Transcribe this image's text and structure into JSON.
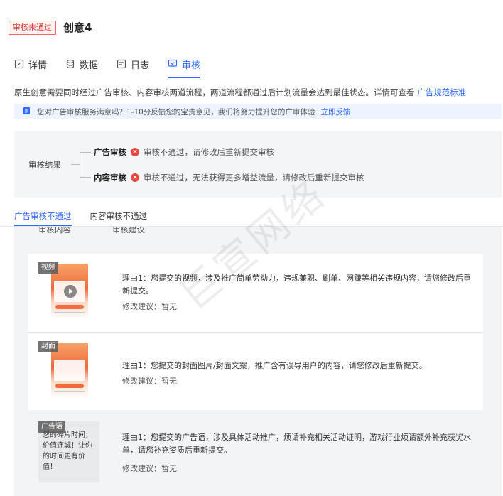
{
  "header": {
    "status_badge": "审核未通过",
    "title": "创意4"
  },
  "tabs": [
    {
      "label": "详情",
      "icon": "edit-icon"
    },
    {
      "label": "数据",
      "icon": "database-icon"
    },
    {
      "label": "日志",
      "icon": "log-icon"
    },
    {
      "label": "审核",
      "icon": "review-icon",
      "active": true
    }
  ],
  "description": {
    "text": "原生创意需要同时经过广告审核、内容审核两道流程，两道流程都通过后计划流量会达到最佳状态。详情可查看",
    "link": "广告规范标准"
  },
  "feedback": {
    "text": "您对广告审核服务满意吗？1-10分反馈您的宝贵意见，我们将努力提升您的广审体验",
    "link": "立即反馈"
  },
  "review_result": {
    "label": "审核结果",
    "rows": [
      {
        "key": "广告审核",
        "message": "审核不通过，请修改后重新提交审核"
      },
      {
        "key": "内容审核",
        "message": "审核不通过，无法获得更多增益流量，请修改后重新提交审核"
      }
    ]
  },
  "subtabs": [
    {
      "label": "广告审核不通过",
      "active": true
    },
    {
      "label": "内容审核不通过"
    }
  ],
  "table": {
    "headers": [
      "审核内容",
      "审核建议"
    ],
    "rows": [
      {
        "tag": "视频",
        "reason": "理由1：您提交的视频，涉及推广简单劳动力，违规兼职、刷单、网赚等相关违规内容，请您修改后重新提交。",
        "suggest": "修改建议：暂无"
      },
      {
        "tag": "封面",
        "reason": "理由1：您提交的封面图片/封面文案，推广含有误导用户的内容，请您修改后重新提交。",
        "suggest": "修改建议：暂无"
      },
      {
        "tag": "广告语",
        "copy": "您的碎片时间，价值连城！让你的时间更有价值！",
        "reason": "理由1：您提交的广告语，涉及具体活动推广，烦请补充相关活动证明，游戏行业烦请额外补充获奖水单，请您补充资质后重新提交。",
        "suggest": "修改建议：暂无"
      }
    ]
  },
  "colors": {
    "accent": "#2f6bff",
    "error": "#e8463f"
  },
  "watermark": "巨宣网络"
}
